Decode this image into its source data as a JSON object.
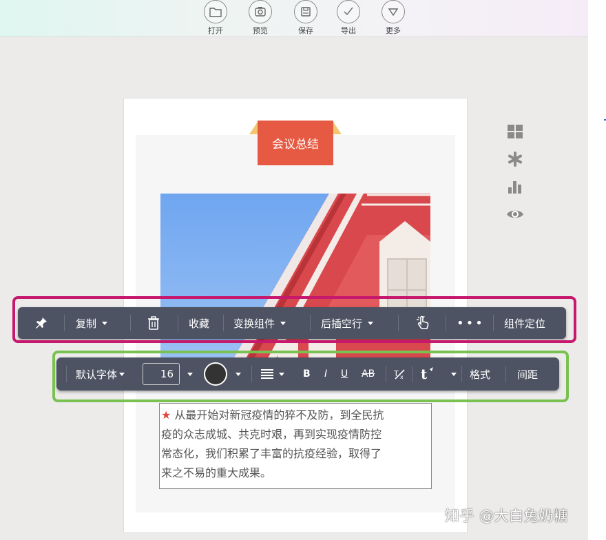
{
  "toolbar": {
    "items": [
      {
        "label": "打开",
        "icon": "folder-icon"
      },
      {
        "label": "预览",
        "icon": "camera-icon"
      },
      {
        "label": "保存",
        "icon": "save-icon"
      },
      {
        "label": "导出",
        "icon": "check-icon"
      },
      {
        "label": "更多",
        "icon": "chevron-down-icon"
      }
    ]
  },
  "page": {
    "title": "会议总结",
    "body_star": "★",
    "body_lines": [
      " 从最开始对新冠疫情的猝不及防，到全民抗",
      "疫的众志成城、共克时艰，再到实现疫情防控",
      "常态化，我们积累了丰富的抗疫经验，取得了",
      "来之不易的重大成果。"
    ]
  },
  "component_toolbar": {
    "pin_icon": "pin-icon",
    "copy": "复制",
    "delete_icon": "trash-icon",
    "favorite": "收藏",
    "swap": "变换组件",
    "insert_after": "后插空行",
    "hand_icon": "pointer-hand-icon",
    "more": "•••",
    "locate": "组件定位"
  },
  "text_toolbar": {
    "font": "默认字体",
    "size": "16",
    "color": "#333333",
    "align_icon": "align-icon",
    "bold": "B",
    "italic": "I",
    "underline": "U",
    "strike": "AB",
    "clear_format_icon": "clear-format-icon",
    "text_effect_icon": "text-effect-icon",
    "format": "格式",
    "spacing": "间距"
  },
  "side_icons": [
    "grid-icon",
    "asterisk-icon",
    "bar-chart-icon",
    "eye-icon"
  ],
  "watermark": "知乎 @大白兔奶糖",
  "colors": {
    "title_bg": "#e65a43",
    "toolbar_bg": "#4d5363",
    "highlight_pink": "#c6186d",
    "highlight_green": "#79c150"
  }
}
